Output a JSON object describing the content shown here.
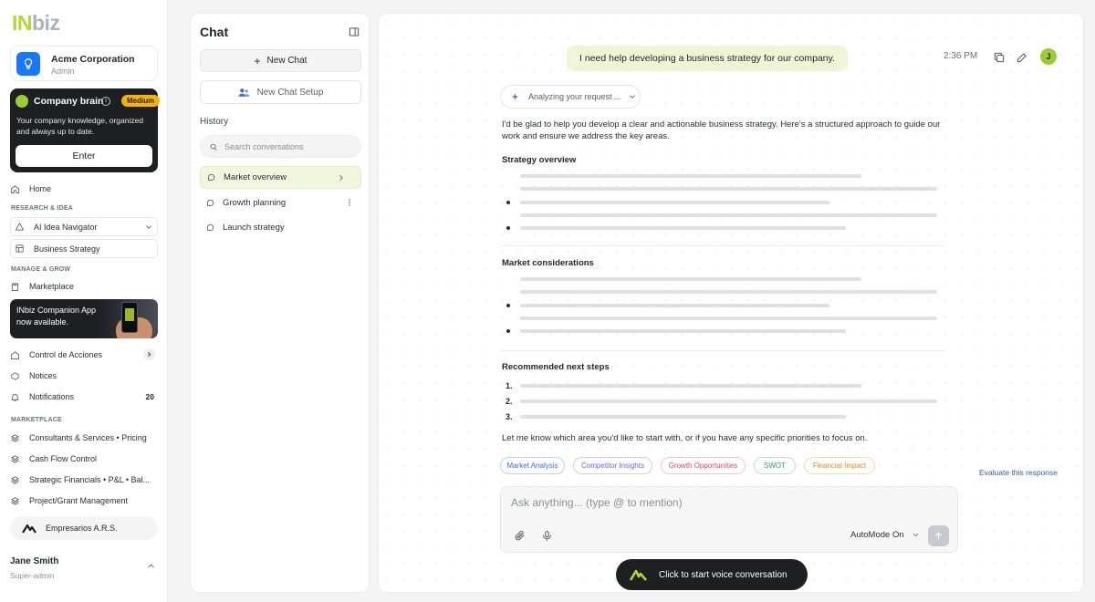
{
  "brand": {
    "logo_in": "IN",
    "logo_biz": "biz"
  },
  "org": {
    "name": "Acme Corporation",
    "role": "Admin"
  },
  "company_brain": {
    "title": "Company brain",
    "badge": "Medium",
    "description": "Your company knowledge, organized and always up to date.",
    "enter_label": "Enter"
  },
  "nav": {
    "home": "Home",
    "section_research": "RESEARCH & IDEA",
    "ai_idea_navigator": "AI Idea Navigator",
    "business_strategy": "Business Strategy",
    "section_manage": "MANAGE & GROW",
    "marketplace": "Marketplace",
    "companion_text": "INbiz Companion App now available.",
    "control_acciones": "Control de Acciones",
    "notices": "Notices",
    "notifications": "Notifications",
    "notifications_count": "20",
    "section_marketplace": "MARKETPLACE",
    "consultants": "Consultants & Services • Pricing",
    "cashflow": "Cash Flow Control",
    "strategic": "Strategic Financials • P&L • Bal...",
    "project": "Project/Grant Management",
    "empresarios": "Empresarios A.R.S."
  },
  "user": {
    "name": "Jane Smith",
    "role": "Super-admin",
    "avatar_letter": "J"
  },
  "chat_panel": {
    "title": "Chat",
    "new_chat": "New Chat",
    "new_chat_setup": "New Chat Setup",
    "history_label": "History",
    "search_placeholder": "Search conversations",
    "history": [
      {
        "label": "Market overview"
      },
      {
        "label": "Growth planning"
      },
      {
        "label": "Launch strategy"
      }
    ]
  },
  "conversation": {
    "user_message": "I need help developing a business strategy for our company.",
    "time": "2:36 PM",
    "analyzing": "Analyzing your request ...",
    "intro": "I'd be glad to help you develop a clear and actionable business strategy. Here's a structured approach to guide our work and ensure we address the key areas.",
    "section1": "Strategy overview",
    "section2": "Market considerations",
    "section3": "Recommended next steps",
    "steps": [
      "1.",
      "2.",
      "3."
    ],
    "outro": "Let me know which area you'd like to start with, or if you have any specific priorities to focus on.",
    "chips": [
      {
        "label": "Market Analysis",
        "color": "#3b6fd1"
      },
      {
        "label": "Competitor Insights",
        "color": "#7b5cd6"
      },
      {
        "label": "Growth Opportunities",
        "color": "#d84a6b"
      },
      {
        "label": "SWOT",
        "color": "#2fa35b"
      },
      {
        "label": "Financial Impact",
        "color": "#e08a1a"
      }
    ],
    "evaluate": "Evaluate this response"
  },
  "composer": {
    "placeholder": "Ask anything... (type @ to mention)",
    "automode": "AutoMode On",
    "voice": "Click to start voice conversation"
  },
  "colors": {
    "accent": "#9acd32",
    "brand_lime": "#b3d72c",
    "dark": "#1d1f23",
    "badge": "#f7b500",
    "link": "#2f5fb0"
  }
}
